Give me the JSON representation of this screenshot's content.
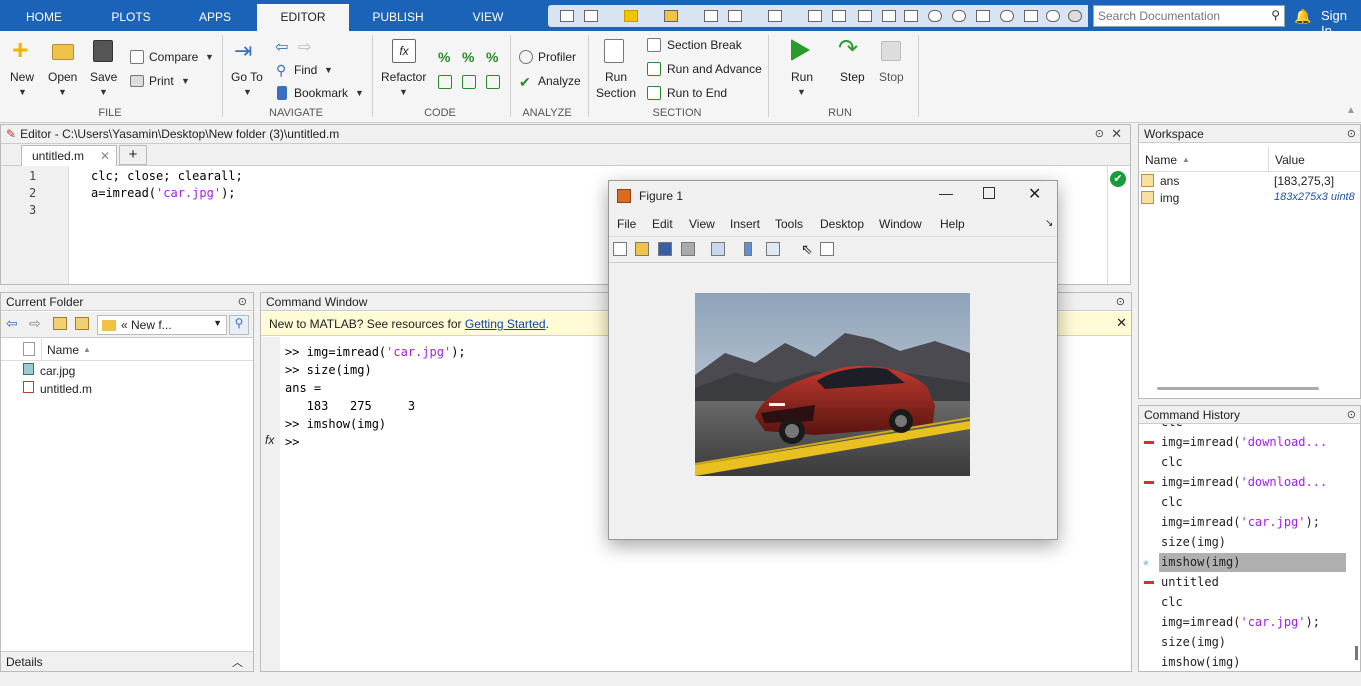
{
  "tabs": [
    "HOME",
    "PLOTS",
    "APPS",
    "EDITOR",
    "PUBLISH",
    "VIEW"
  ],
  "search": {
    "placeholder": "Search Documentation"
  },
  "signin": "Sign In",
  "ribbon": {
    "file": {
      "group": "FILE",
      "new": "New",
      "open": "Open",
      "save": "Save",
      "compare": "Compare",
      "print": "Print"
    },
    "navigate": {
      "group": "NAVIGATE",
      "goto": "Go To",
      "find": "Find",
      "bookmark": "Bookmark"
    },
    "code": {
      "group": "CODE",
      "refactor": "Refactor"
    },
    "analyze": {
      "group": "ANALYZE",
      "profiler": "Profiler",
      "analyze": "Analyze"
    },
    "section": {
      "group": "SECTION",
      "run_section": "Run",
      "run_section2": "Section",
      "section_break": "Section Break",
      "run_advance": "Run and Advance",
      "run_end": "Run to End"
    },
    "run": {
      "group": "RUN",
      "run": "Run",
      "step": "Step",
      "stop": "Stop"
    }
  },
  "editor": {
    "title": "Editor - C:\\Users\\Yasamin\\Desktop\\New folder (3)\\untitled.m",
    "tab": "untitled.m",
    "lines": [
      {
        "n": "1",
        "pre": "clc; close; clearall;",
        "str": "",
        "post": ""
      },
      {
        "n": "2",
        "pre": "a=imread(",
        "str": "'car.jpg'",
        "post": ");"
      },
      {
        "n": "3",
        "pre": "",
        "str": "",
        "post": ""
      }
    ]
  },
  "current_folder": {
    "title": "Current Folder",
    "path": "« New f...",
    "col": "Name",
    "files": [
      "car.jpg",
      "untitled.m"
    ],
    "details": "Details"
  },
  "command_window": {
    "title": "Command Window",
    "notice": "New to MATLAB? See resources for ",
    "notice_link": "Getting Started",
    "notice_end": ".",
    "lines": [
      {
        "pre": ">> img=imread(",
        "str": "'car.jpg'",
        "post": ");"
      },
      {
        "pre": ">> size(img)",
        "str": "",
        "post": ""
      },
      {
        "pre": "ans =",
        "str": "",
        "post": ""
      },
      {
        "pre": "   183   275     3",
        "str": "",
        "post": ""
      },
      {
        "pre": ">> imshow(img)",
        "str": "",
        "post": ""
      },
      {
        "pre": ">>",
        "str": "",
        "post": ""
      }
    ]
  },
  "figure": {
    "title": "Figure 1",
    "menu": [
      "File",
      "Edit",
      "View",
      "Insert",
      "Tools",
      "Desktop",
      "Window",
      "Help"
    ]
  },
  "workspace": {
    "title": "Workspace",
    "col_name": "Name",
    "col_value": "Value",
    "vars": [
      {
        "name": "ans",
        "value": "[183,275,3]"
      },
      {
        "name": "img",
        "value": "183x275x3 uint8"
      }
    ]
  },
  "history": {
    "title": "Command History",
    "items": [
      {
        "pre": "clc",
        "str": "",
        "post": ""
      },
      {
        "pre": "img=imread(",
        "str": "'download...",
        "post": ""
      },
      {
        "pre": "clc",
        "str": "",
        "post": ""
      },
      {
        "pre": "img=imread(",
        "str": "'download...",
        "post": ""
      },
      {
        "pre": "clc",
        "str": "",
        "post": ""
      },
      {
        "pre": "img=imread(",
        "str": "'car.jpg'",
        "post": ");"
      },
      {
        "pre": "size(img)",
        "str": "",
        "post": ""
      },
      {
        "pre": "imshow(img)",
        "str": "",
        "post": ""
      },
      {
        "pre": "untitled",
        "str": "",
        "post": ""
      },
      {
        "pre": "clc",
        "str": "",
        "post": ""
      },
      {
        "pre": "img=imread(",
        "str": "'car.jpg'",
        "post": ");"
      },
      {
        "pre": "size(img)",
        "str": "",
        "post": ""
      },
      {
        "pre": "imshow(img)",
        "str": "",
        "post": ""
      }
    ]
  },
  "colors": {
    "titlebar": "#1a63b8",
    "string": "#a020f0",
    "marker": "#cc3333",
    "ok": "#1a9a3a"
  }
}
